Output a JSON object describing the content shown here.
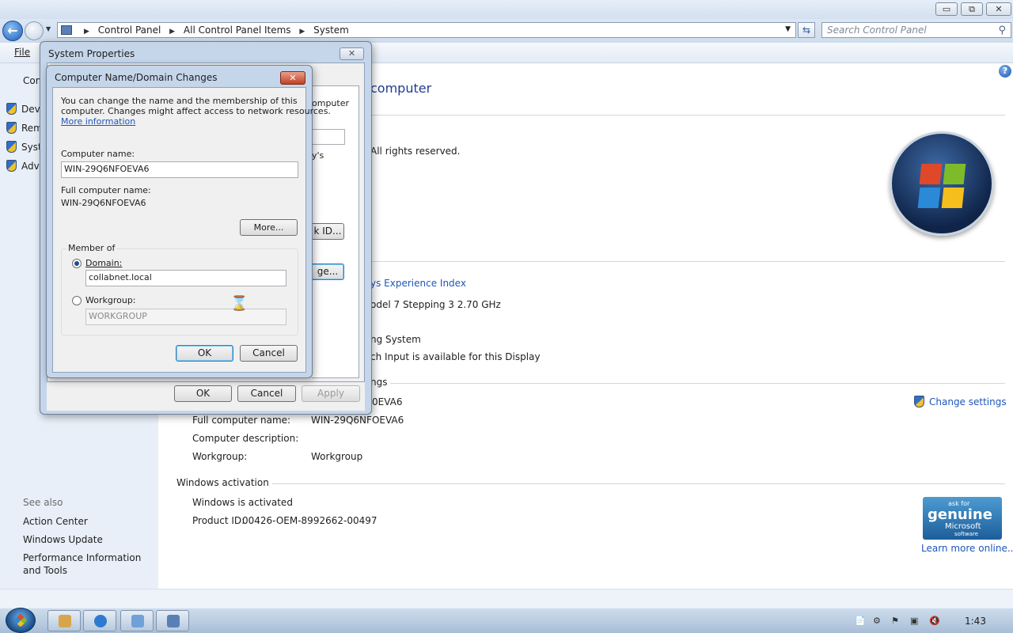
{
  "window": {
    "minimize": "▭",
    "maximize": "⧉",
    "close": "✕"
  },
  "address": {
    "crumbs": [
      "Control Panel",
      "All Control Panel Items",
      "System"
    ],
    "search_placeholder": "Search Control Panel"
  },
  "menu": {
    "file": "File"
  },
  "sidebar": {
    "heading": "Con",
    "tasks": [
      {
        "label": "Dev",
        "icon": "shield-icon"
      },
      {
        "label": "Rem",
        "icon": "shield-icon"
      },
      {
        "label": "Syst",
        "icon": "shield-icon"
      },
      {
        "label": "Adv",
        "icon": "shield-icon"
      }
    ],
    "see_also": "See also",
    "links": [
      "Action Center",
      "Windows Update",
      "Performance Information and Tools"
    ]
  },
  "main": {
    "title_fragment": "computer",
    "copyright_fragment": "All rights reserved.",
    "experience_fragment": "ys Experience Index",
    "processor_fragment": "odel 7 Stepping 3   2.70 GHz",
    "ostype_fragment": "ng System",
    "pen_fragment": "ch Input is available for this Display",
    "settings_section_fragment": "ngs",
    "computer_name_value_fragment": "0EVA6",
    "change_settings": "Change settings",
    "full_name_label": "Full computer name:",
    "full_name_value": "WIN-29Q6NFOEVA6",
    "description_label": "Computer description:",
    "workgroup_label": "Workgroup:",
    "workgroup_value": "Workgroup",
    "activation_section": "Windows activation",
    "activation_status": "Windows is activated",
    "product_id_label": "Product ID:",
    "product_id_value": "00426-OEM-8992662-00497",
    "genuine": {
      "ask": "ask for",
      "genuine": "genuine",
      "microsoft": "Microsoft",
      "software": "software"
    },
    "learn_more": "Learn more online..."
  },
  "system_properties": {
    "title": "System Properties",
    "close": "✕",
    "behind_fragments": [
      "omputer",
      "y's",
      "k ID...",
      "ge..."
    ],
    "ok": "OK",
    "cancel": "Cancel",
    "apply": "Apply"
  },
  "name_dialog": {
    "title": "Computer Name/Domain Changes",
    "close": "✕",
    "intro_line1": "You can change the name and the membership of this",
    "intro_line2": "computer. Changes might affect access to network resources.",
    "more_info": "More information",
    "computer_name_label": "Computer name:",
    "computer_name_value": "WIN-29Q6NFOEVA6",
    "full_name_label": "Full computer name:",
    "full_name_value": "WIN-29Q6NFOEVA6",
    "more_button": "More...",
    "member_of": "Member of",
    "domain_label": "Domain:",
    "domain_value": "collabnet.local",
    "domain_selected": true,
    "workgroup_label": "Workgroup:",
    "workgroup_value": "WORKGROUP",
    "ok": "OK",
    "cancel": "Cancel"
  },
  "taskbar": {
    "clock": "1:43"
  }
}
